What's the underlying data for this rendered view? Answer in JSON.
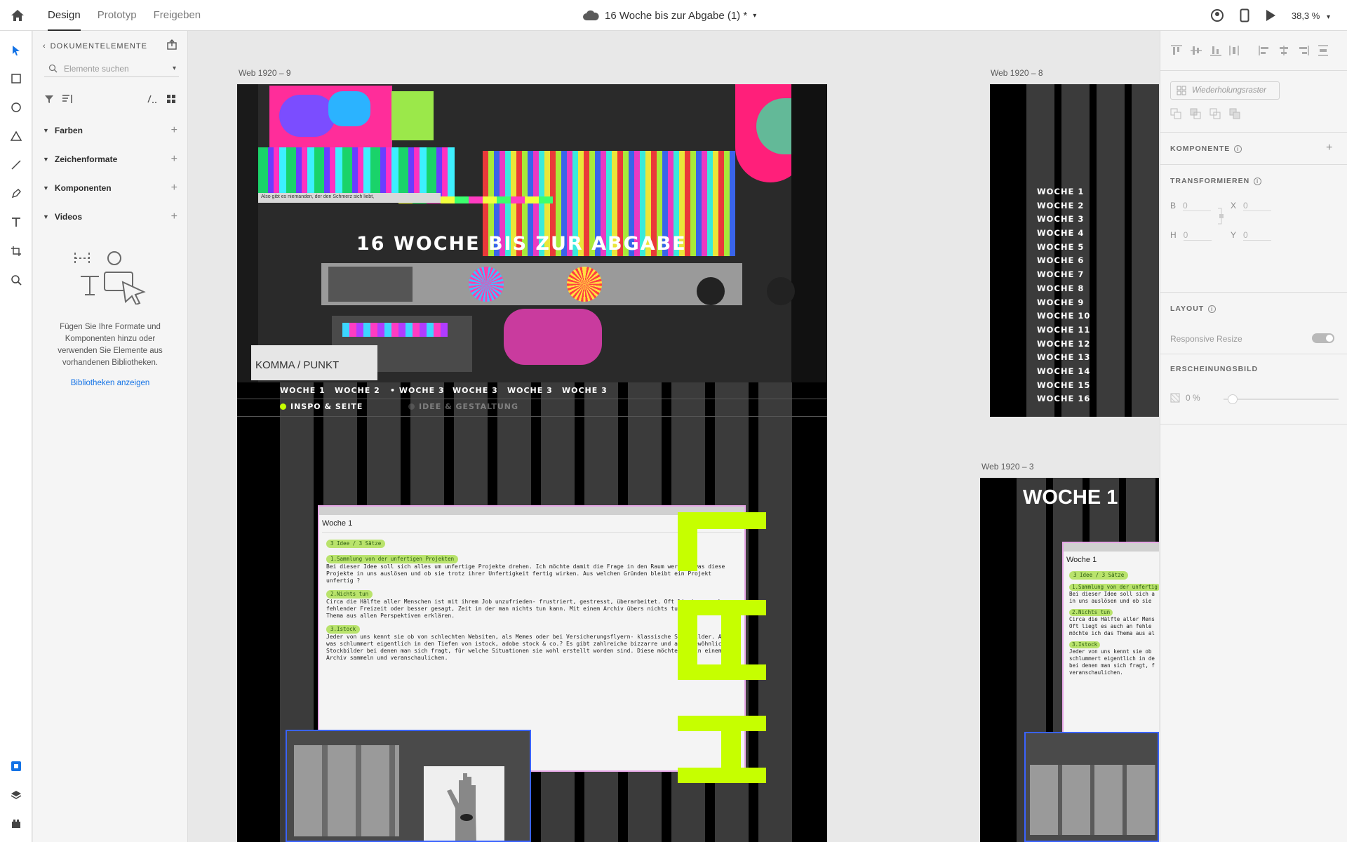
{
  "topbar": {
    "tabs": [
      "Design",
      "Prototyp",
      "Freigeben"
    ],
    "doc_title": "16 Woche bis zur Abgabe (1) *",
    "zoom": "38,3 %"
  },
  "assets": {
    "header": "DOKUMENTELEMENTE",
    "search_placeholder": "Elemente suchen",
    "sections": [
      "Farben",
      "Zeichenformate",
      "Komponenten",
      "Videos"
    ],
    "empty_text": "Fügen Sie Ihre Formate und Komponenten hinzu oder verwenden Sie Elemente aus vorhandenen Bibliotheken.",
    "link": "Bibliotheken anzeigen"
  },
  "canvas": {
    "board1": {
      "label": "Web 1920 – 9",
      "hero_title": "16 WOCHE BIS ZUR ABGABE",
      "logo": "KOMMA / PUNKT",
      "collage_text": "Also gibt es niemanden, der den Schmerz sich liebt,",
      "nav": [
        "WOCHE 1",
        "WOCHE 2",
        "• WOCHE 3",
        "WOCHE 3",
        "WOCHE 3",
        "WOCHE 3"
      ],
      "subnav": [
        "INSPO & SEITE",
        "IDEE & GESTALTUNG"
      ],
      "note": {
        "title": "Woche 1",
        "tag": "3 Idee / 3 Sätze",
        "items": [
          {
            "tag": "1.Sammlung von der unfertigen Projekten",
            "text": "Bei dieser Idee soll sich alles um unfertige Projekte drehen. Ich möchte damit die Frage in den Raum werfen, was diese Projekte in uns auslösen und ob sie trotz ihrer Unfertigkeit fertig wirken. Aus welchen Gründen bleibt ein Projekt unfertig ?"
          },
          {
            "tag": "2.Nichts tun",
            "text": "Circa die Hälfte aller Menschen ist mit ihrem Job unzufrieden- frustriert, gestresst, überarbeitet. Oft liegt es auch an fehlender Freizeit oder besser gesagt, Zeit in der man nichts tun kann. Mit einem Archiv übers nichts tun möchte ich das Thema aus allen Perspektiven erklären."
          },
          {
            "tag": "3.Istock",
            "text": "Jeder von uns kennt sie ob von schlechten Websiten, als Memes oder bei Versicherungsflyern- klassische Stockbilder. Aber was schlummert eigentlich in den Tiefen von istock, adobe stock & co.? Es gibt zahlreiche bizzarre und außergewöhnliche Stockbilder bei denen man sich fragt, für welche Situationen sie wohl erstellt worden sind. Diese möchte ich in einem Archiv sammeln und veranschaulichen."
          }
        ]
      }
    },
    "board2": {
      "label": "Web 1920 – 8",
      "weeks": [
        "WOCHE 1",
        "WOCHE 2",
        "WOCHE 3",
        "WOCHE 4",
        "WOCHE 5",
        "WOCHE 6",
        "WOCHE 7",
        "WOCHE 8",
        "WOCHE 9",
        "WOCHE 10",
        "WOCHE 11",
        "WOCHE 12",
        "WOCHE 13",
        "WOCHE 14",
        "WOCHE 15",
        "WOCHE 16"
      ]
    },
    "board3": {
      "label": "Web 1920 – 3",
      "title": "WOCHE 1",
      "note_title": "Woche 1",
      "note_tag": "3 Idee / 3 Sätze",
      "lines": [
        "1.Sammlung von der unfertig",
        "Bei dieser Idee soll sich a",
        "in uns auslösen und ob sie",
        "2.Nichts tun",
        "Circa die Hälfte aller Mens",
        "Oft liegt es auch an fehle",
        "möchte ich das Thema aus al",
        "3.Istock",
        "Jeder von uns kennt sie ob",
        "schlummert eigentlich in de",
        "bei denen man sich fragt, f",
        "veranschaulichen."
      ]
    }
  },
  "props": {
    "repeat_grid": "Wiederholungsraster",
    "komponente": "KOMPONENTE",
    "transform": "TRANSFORMIEREN",
    "fields": {
      "B": "B",
      "H": "H",
      "X": "X",
      "Y": "Y",
      "b": "0",
      "h": "0",
      "x": "0",
      "y": "0"
    },
    "layout": "LAYOUT",
    "responsive": "Responsive Resize",
    "appearance": "ERSCHEINUNGSBILD",
    "opacity": "0 %"
  }
}
